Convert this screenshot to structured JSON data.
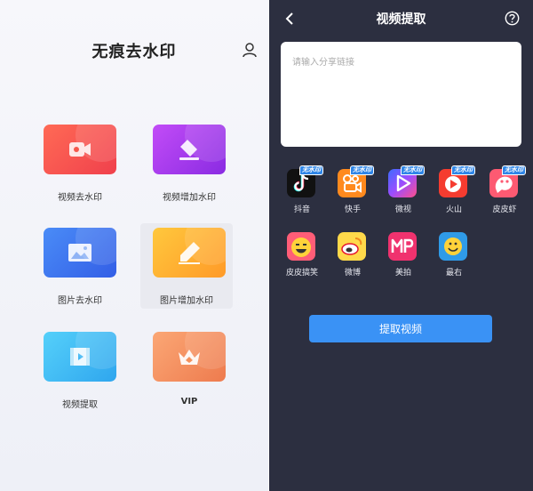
{
  "home": {
    "title": "无痕去水印",
    "icons": {
      "user": "user-icon"
    },
    "tiles": [
      {
        "label": "视频去水印",
        "icon": "video-camera-icon",
        "color": "#f5574b"
      },
      {
        "label": "视频增加水印",
        "icon": "eraser-icon",
        "color": "#a83bf0"
      },
      {
        "label": "图片去水印",
        "icon": "image-icon",
        "color": "#3c77f0"
      },
      {
        "label": "图片增加水印",
        "icon": "pencil-icon",
        "color": "#fdb033"
      },
      {
        "label": "视频提取",
        "icon": "film-icon",
        "color": "#41b8f5"
      },
      {
        "label": "VIP",
        "icon": "crown-icon",
        "color": "#f4905c"
      }
    ]
  },
  "extract": {
    "title": "视频提取",
    "icons": {
      "back": "back-icon",
      "help": "help-icon"
    },
    "input_placeholder": "请输入分享链接",
    "badge_text": "无水印",
    "platforms": [
      {
        "name": "抖音",
        "icon": "douyin-icon",
        "badge": true
      },
      {
        "name": "快手",
        "icon": "kuaishou-icon",
        "badge": true
      },
      {
        "name": "微视",
        "icon": "weishi-icon",
        "badge": true
      },
      {
        "name": "火山",
        "icon": "huoshan-icon",
        "badge": true
      },
      {
        "name": "皮皮虾",
        "icon": "pipixia-icon",
        "badge": true
      },
      {
        "name": "皮皮搞笑",
        "icon": "pipigaoxiao-icon",
        "badge": false
      },
      {
        "name": "微博",
        "icon": "weibo-icon",
        "badge": false
      },
      {
        "name": "美拍",
        "icon": "meipai-icon",
        "badge": false
      },
      {
        "name": "最右",
        "icon": "zuiyou-icon",
        "badge": false
      }
    ],
    "button_label": "提取视频",
    "accent": "#3a92f5",
    "background": "#2c2f40"
  }
}
